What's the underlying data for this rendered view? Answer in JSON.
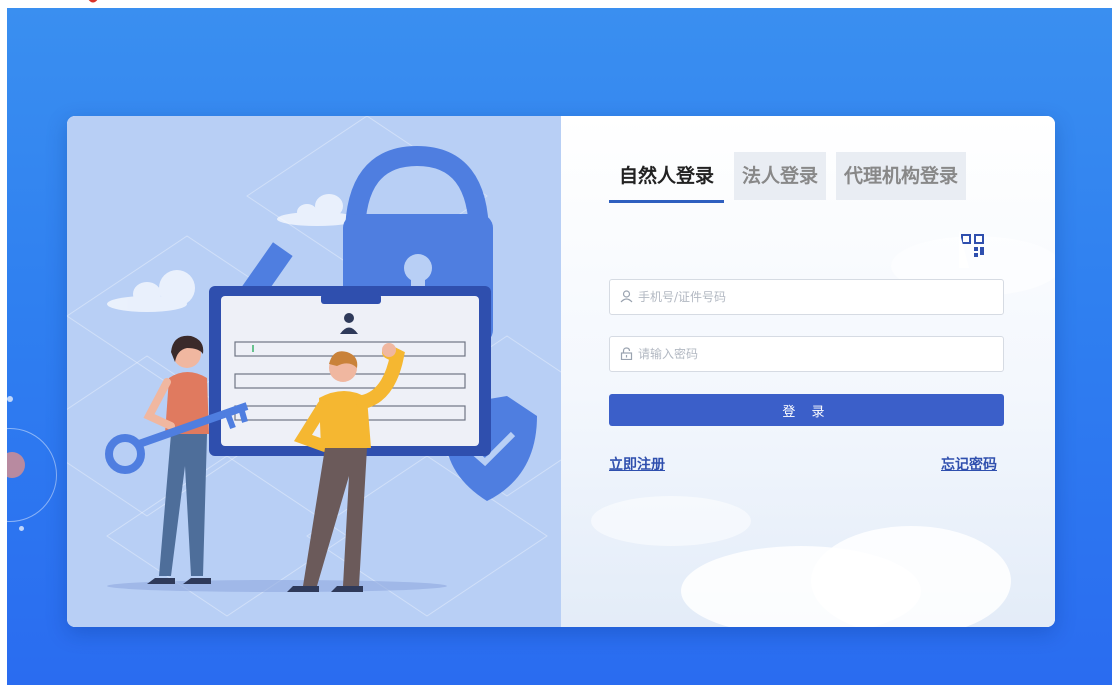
{
  "tabs": [
    {
      "label": "自然人登录",
      "active": true
    },
    {
      "label": "法人登录",
      "active": false
    },
    {
      "label": "代理机构登录",
      "active": false
    }
  ],
  "form": {
    "account_placeholder": "手机号/证件号码",
    "password_placeholder": "请输入密码",
    "login_label": "登 录",
    "register_label": "立即注册",
    "forgot_label": "忘记密码"
  },
  "icons": {
    "account": "user-icon",
    "password": "lock-icon",
    "qr": "qr-code-icon"
  },
  "colors": {
    "background": "#2f7ff0",
    "primary_button": "#3b5fc9",
    "link": "#2f4fae",
    "active_tab_underline": "#2f5fbf",
    "illustration_bg": "#b8cff5"
  }
}
